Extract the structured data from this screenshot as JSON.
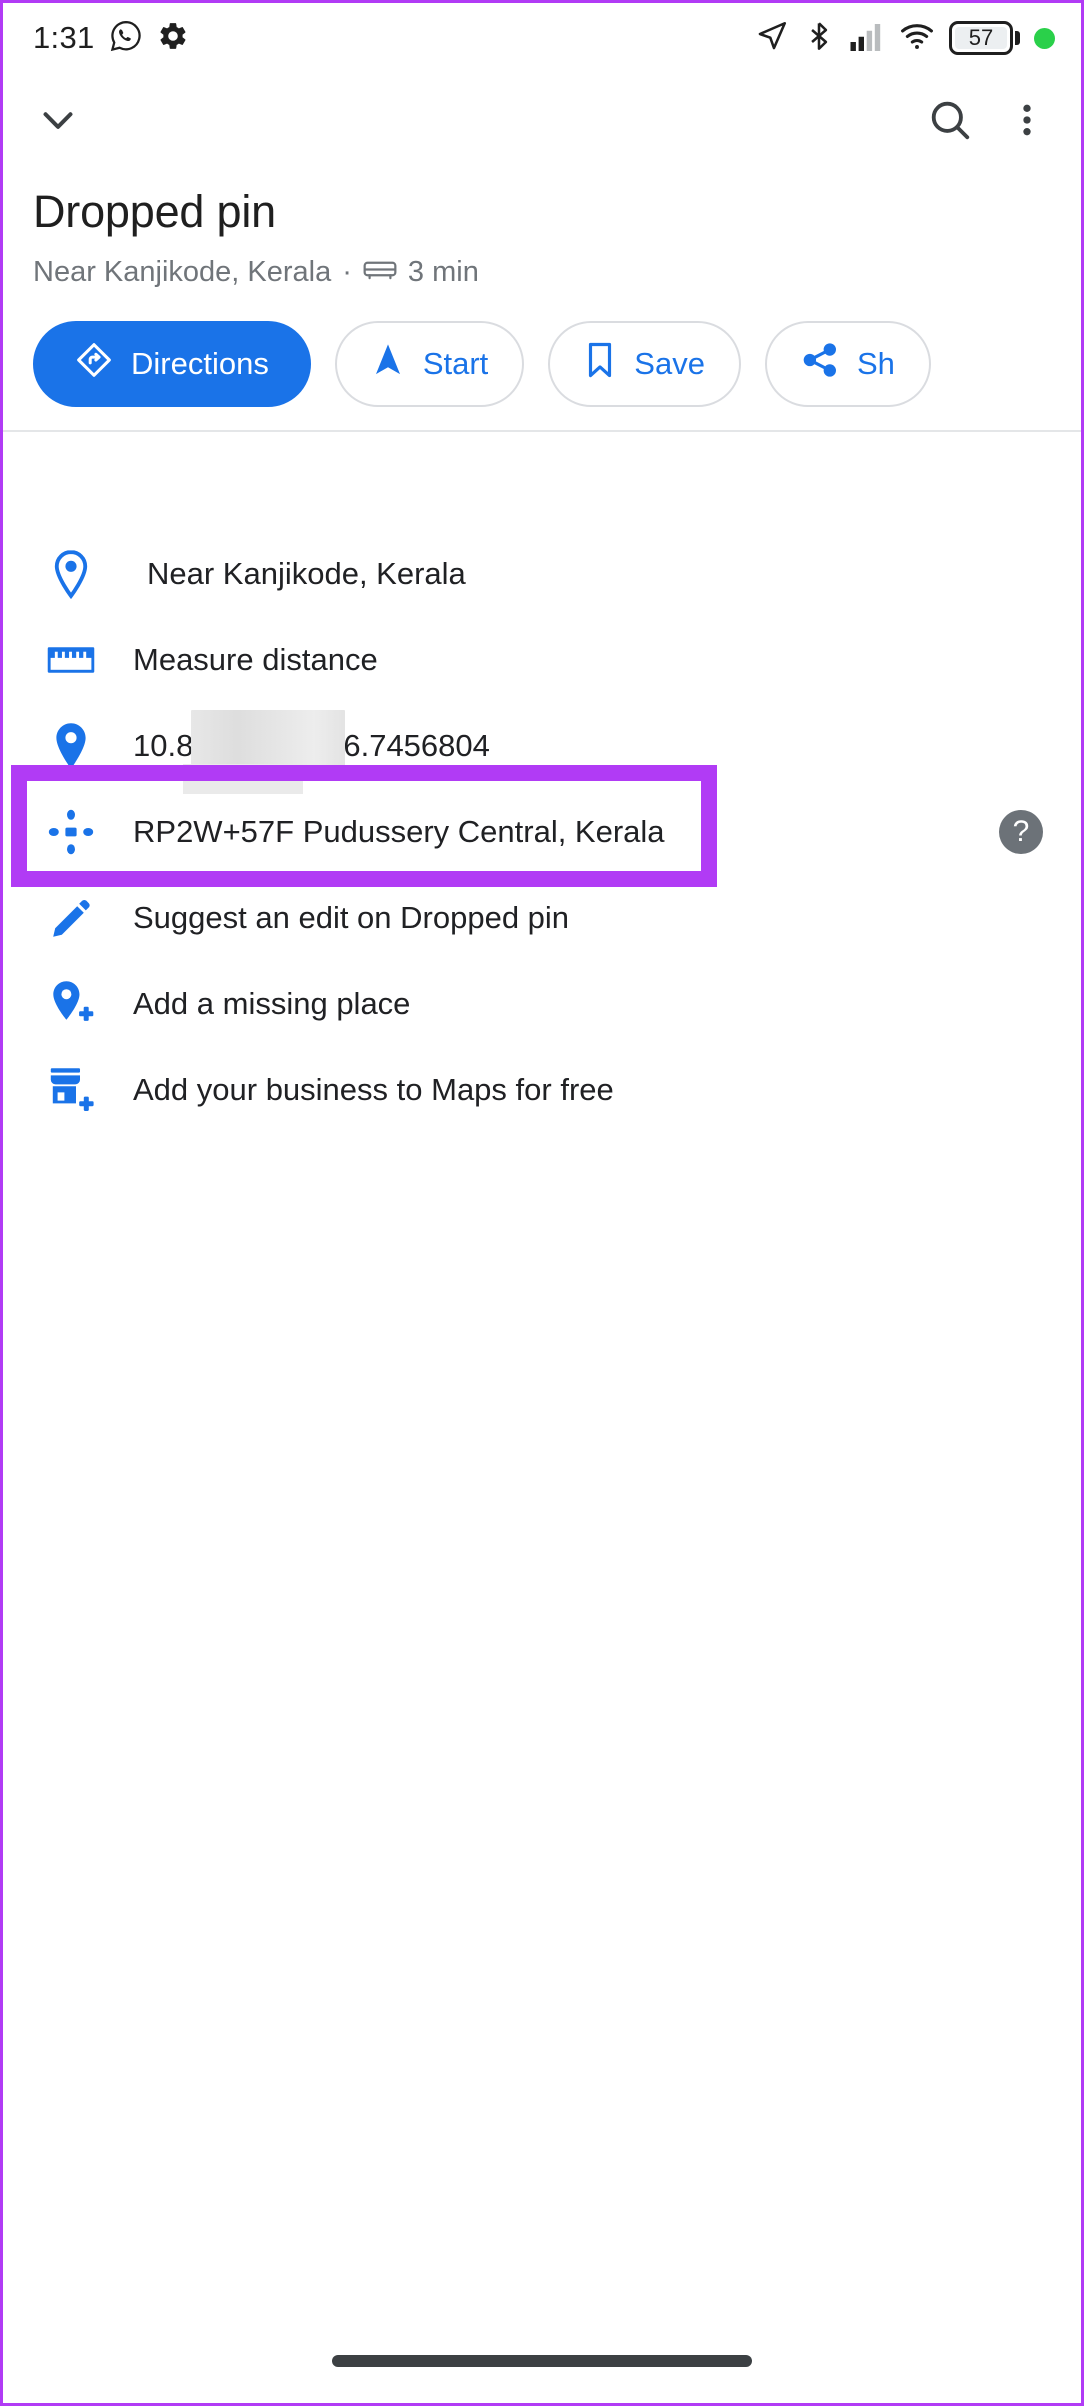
{
  "status_bar": {
    "time": "1:31",
    "battery_level": "57",
    "left_icons": [
      "whatsapp-icon",
      "gear-icon"
    ],
    "right_icons": [
      "location-arrow-icon",
      "bluetooth-icon",
      "signal-bars-icon",
      "wifi-icon",
      "battery-icon",
      "green-dot-indicator"
    ]
  },
  "top_bar": {
    "collapse_label": "chevron-down-icon",
    "search_label": "search-icon",
    "overflow_label": "more-options-icon"
  },
  "place": {
    "title": "Dropped pin",
    "subtitle_location": "Near Kanjikode, Kerala",
    "subtitle_separator": "·",
    "subtitle_travel_time": "3 min",
    "travel_mode_icon": "car-icon"
  },
  "actions": [
    {
      "label": "Directions",
      "icon": "directions-icon",
      "primary": true
    },
    {
      "label": "Start",
      "icon": "navigation-arrow-icon",
      "primary": false
    },
    {
      "label": "Save",
      "icon": "bookmark-icon",
      "primary": false
    },
    {
      "label": "Sh",
      "icon": "share-icon",
      "primary": false
    }
  ],
  "list": {
    "address": {
      "label": "Near Kanjikode, Kerala",
      "icon": "map-pin-icon"
    },
    "measure": {
      "label": "Measure distance",
      "icon": "ruler-icon"
    },
    "coordinates": {
      "prefix": "10.8",
      "suffix": "6.7456804",
      "redacted": true,
      "icon": "map-pin-filled-icon"
    },
    "plus_code": {
      "label": "RP2W+57F Pudussery Central, Kerala",
      "icon": "plus-code-icon",
      "help": "?"
    },
    "suggest_edit": {
      "label": "Suggest an edit on Dropped pin",
      "icon": "pencil-icon"
    },
    "add_place": {
      "label": "Add a missing place",
      "icon": "add-place-icon"
    },
    "add_business": {
      "label": "Add your business to Maps for free",
      "icon": "add-business-icon"
    }
  },
  "colors": {
    "accent_blue": "#1a73e8",
    "highlight_purple": "#b13bf5",
    "text_primary": "#202124",
    "text_secondary": "#70757a",
    "battery_green": "#2ad04a"
  }
}
